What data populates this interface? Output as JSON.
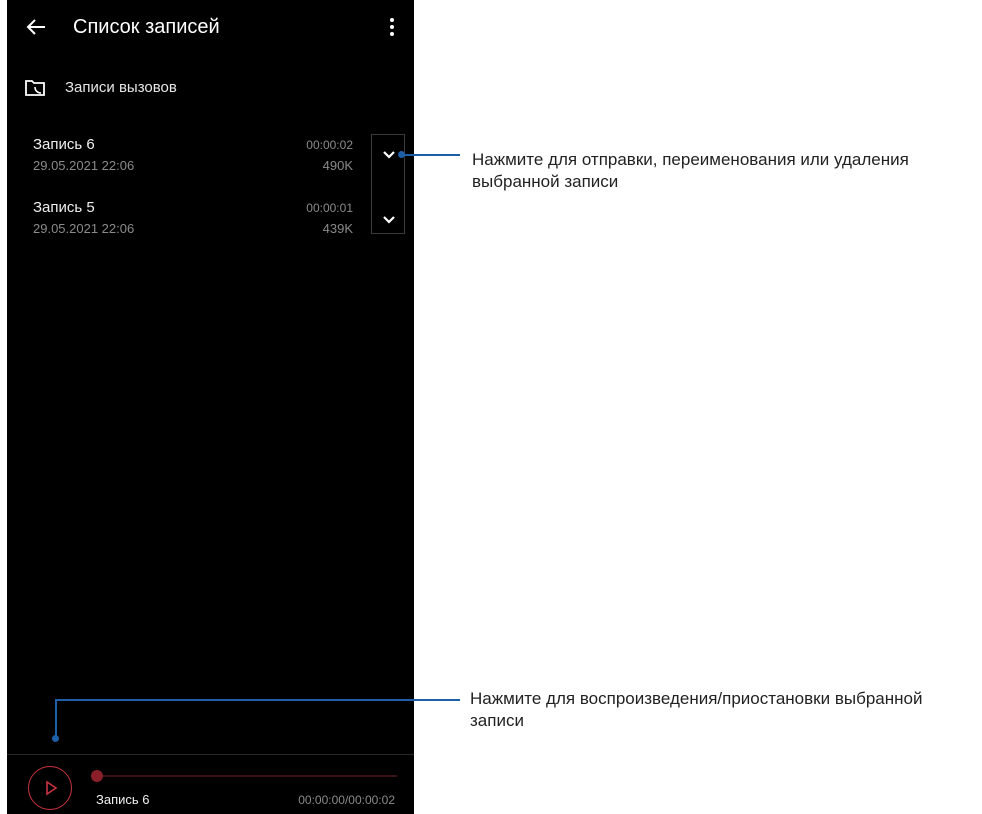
{
  "app": {
    "title": "Список записей",
    "back_icon": "arrow-left-icon",
    "menu_icon": "more-vertical-icon"
  },
  "folder": {
    "label": "Записи вызовов",
    "icon": "call-folder-icon"
  },
  "recordings": [
    {
      "name": "Запись 6",
      "date": "29.05.2021 22:06",
      "duration": "00:00:02",
      "size": "490K"
    },
    {
      "name": "Запись 5",
      "date": "29.05.2021 22:06",
      "duration": "00:00:01",
      "size": "439K"
    }
  ],
  "player": {
    "name": "Запись 6",
    "time": "00:00:00/00:00:02",
    "progress": 0,
    "accent": "#c8323f",
    "play_icon": "play-icon"
  },
  "callouts": {
    "expand": "Нажмите для отправки, переименования или удаления выбранной записи",
    "play": "Нажмите для воспроизведения/приостановки выбранной записи",
    "line_color": "#1c5ea8"
  }
}
